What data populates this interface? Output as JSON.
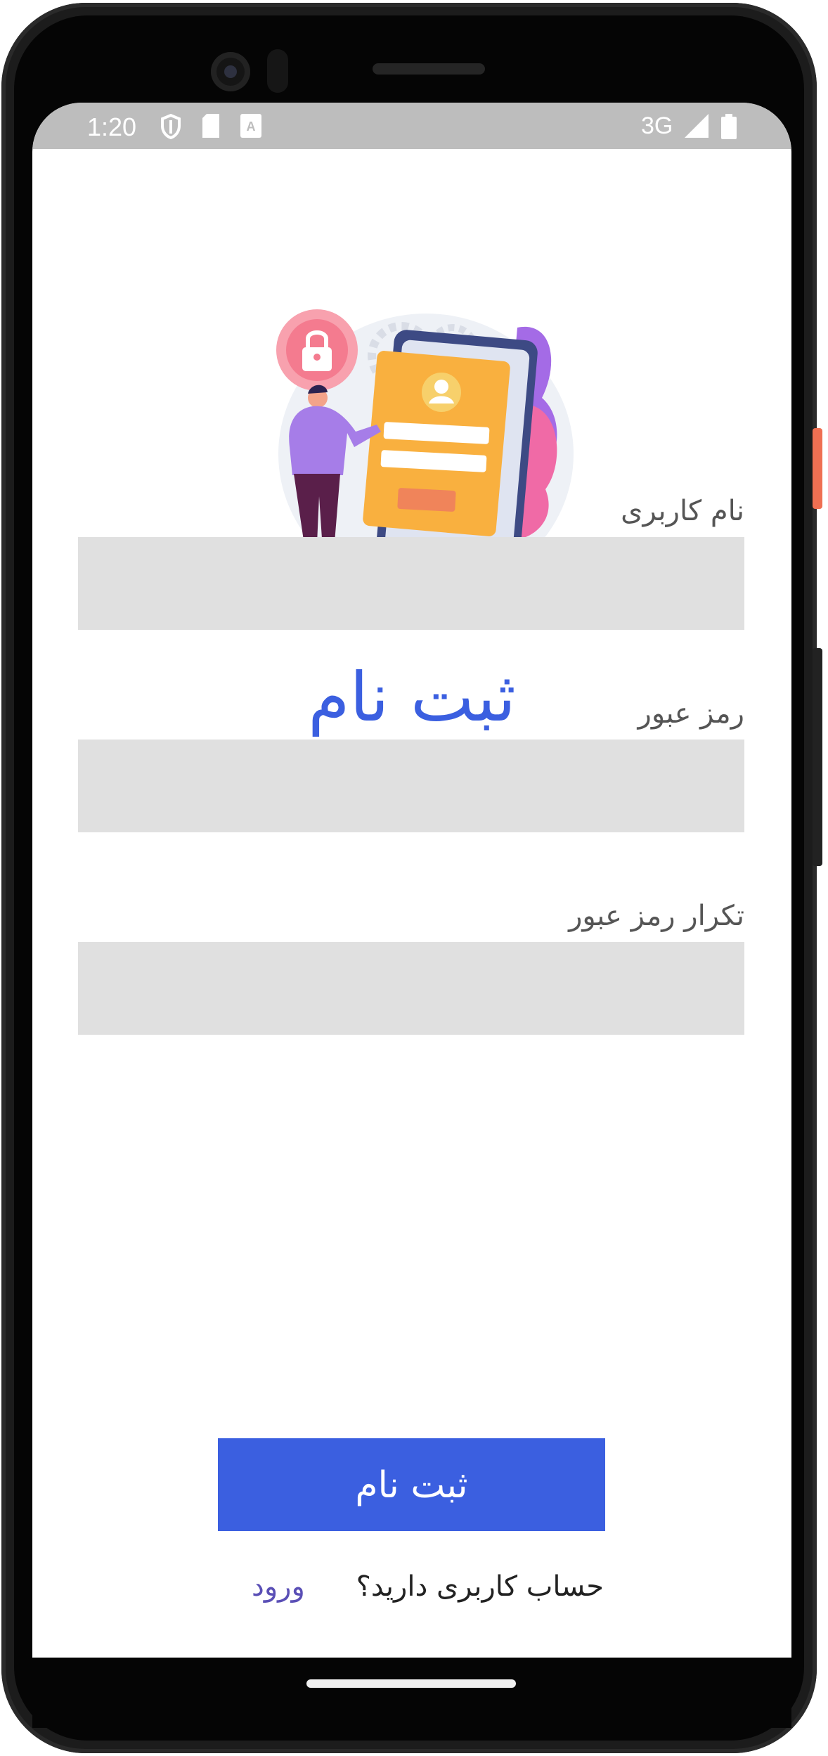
{
  "status_bar": {
    "time": "1:20",
    "network": "3G",
    "icons": [
      "shield-icon",
      "sd-card-icon",
      "font-a-icon",
      "signal-icon",
      "battery-icon"
    ]
  },
  "page": {
    "title": "ثبت نام"
  },
  "form": {
    "username_label": "نام کاربری",
    "username_value": "",
    "password_label": "رمز عبور",
    "password_value": "",
    "confirm_label": "تکرار رمز عبور",
    "confirm_value": "",
    "submit_label": "ثبت نام"
  },
  "footer": {
    "question": "حساب کاربری دارید؟",
    "login_link": "ورود"
  },
  "colors": {
    "accent": "#3b5fe0",
    "field_bg": "#e0e0e0",
    "link": "#5a4fb6",
    "status_bar": "#bdbdbd"
  }
}
